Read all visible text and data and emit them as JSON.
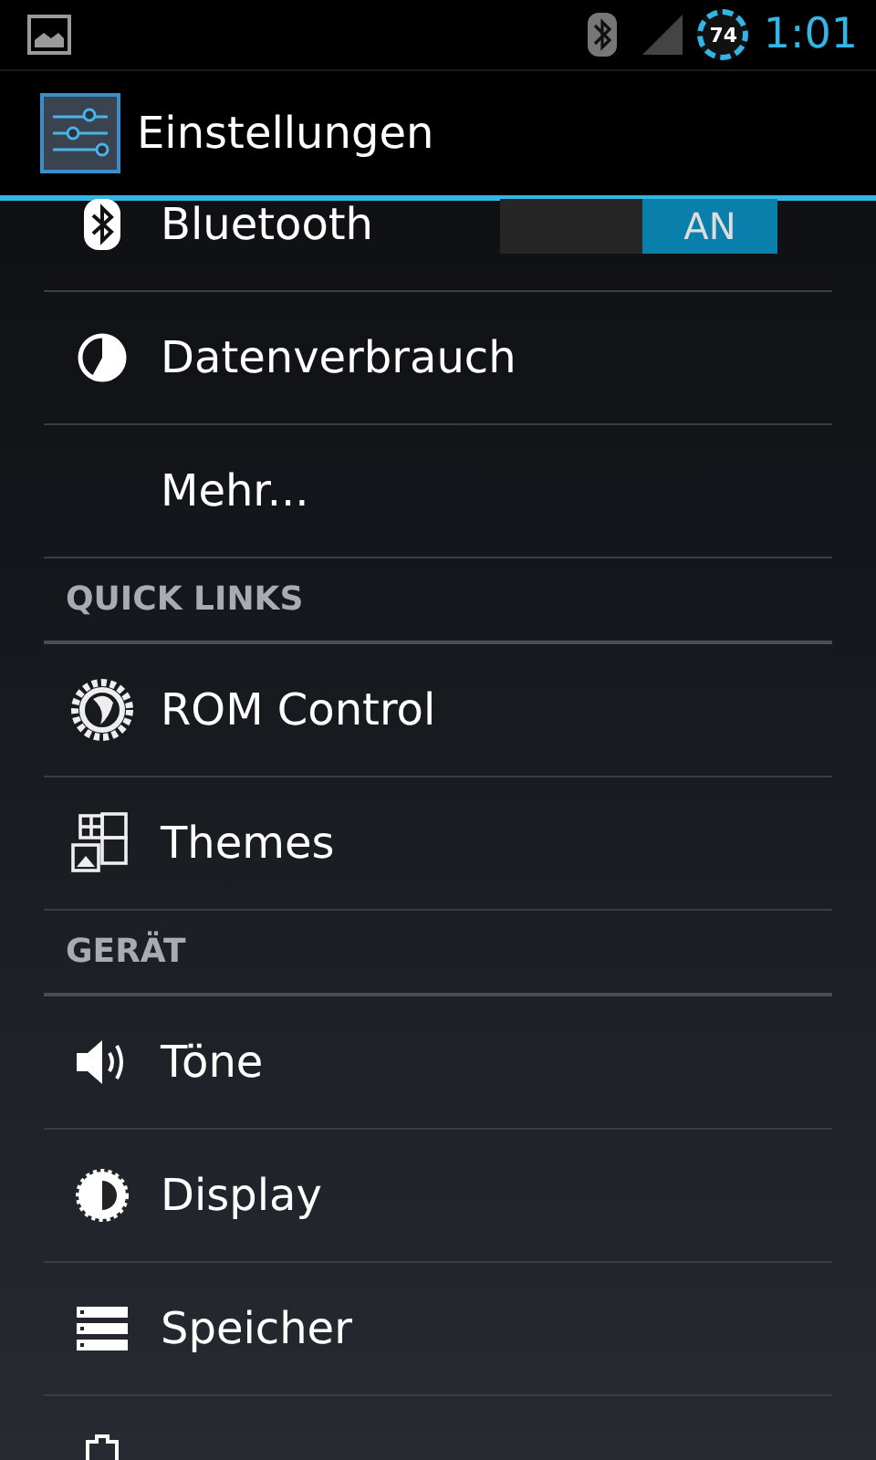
{
  "status_bar": {
    "battery": "74",
    "time": "1:01"
  },
  "action_bar": {
    "title": "Einstellungen"
  },
  "rows": [
    {
      "kind": "switch",
      "label": "Bluetooth",
      "switch": {
        "label": "AN",
        "on": true
      }
    },
    {
      "kind": "item",
      "label": "Datenverbrauch"
    },
    {
      "kind": "item",
      "label": "Mehr..."
    },
    {
      "kind": "header",
      "label": "QUICK LINKS"
    },
    {
      "kind": "item",
      "label": "ROM Control"
    },
    {
      "kind": "item",
      "label": "Themes"
    },
    {
      "kind": "header",
      "label": "GERÄT"
    },
    {
      "kind": "item",
      "label": "Töne"
    },
    {
      "kind": "item",
      "label": "Display"
    },
    {
      "kind": "item",
      "label": "Speicher"
    },
    {
      "kind": "item"
    }
  ]
}
